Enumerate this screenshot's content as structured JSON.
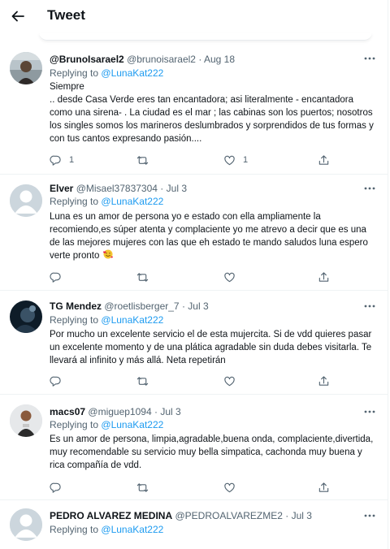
{
  "header": {
    "title": "Tweet"
  },
  "replying_label": "Replying to",
  "tweets": [
    {
      "name": "@BrunoIsarael2",
      "handle": "@brunoisarael2",
      "dot": "·",
      "date": "Aug 18",
      "reply_to": "@LunaKat222",
      "body": "Siempre\n.. desde Casa Verde eres tan encantadora; asi literalmente - encantadora como una sirena-  . La ciudad es el mar ; las cabinas son los puertos; nosotros los singles somos los marineros deslumbrados y sorprendidos  de tus formas y con tus cantos expresando pasión....",
      "replies": "1",
      "likes": "1"
    },
    {
      "name": "Elver",
      "handle": "@Misael37837304",
      "dot": "·",
      "date": "Jul 3",
      "reply_to": "@LunaKat222",
      "body": "Luna es un amor de persona yo e estado con ella ampliamente la recomiendo,es súper atenta y complaciente yo me atrevo a decir que es una de las mejores mujeres con las que eh estado te mando saludos luna espero verte pronto",
      "emoji": "smiling-face-with-hearts",
      "replies": "",
      "likes": ""
    },
    {
      "name": "TG Mendez",
      "handle": "@roetlisberger_7",
      "dot": "·",
      "date": "Jul 3",
      "reply_to": "@LunaKat222",
      "body": "Por mucho un excelente servicio el de esta mujercita. Si de vdd quieres pasar un excelente momento y de una plática agradable sin duda debes visitarla. Te llevará al infinito y más allá. Neta repetirán",
      "replies": "",
      "likes": ""
    },
    {
      "name": "macs07",
      "handle": "@miguep1094",
      "dot": "·",
      "date": "Jul 3",
      "reply_to": "@LunaKat222",
      "body": "Es un amor de persona, limpia,agradable,buena onda, complaciente,divertida, muy recomendable su servicio muy bella simpatica, cachonda muy buena y rica compañía de vdd.",
      "replies": "",
      "likes": ""
    },
    {
      "name": "PEDRO ALVAREZ MEDINA",
      "handle": "@PEDROALVAREZME2",
      "dot": "·",
      "date": "Jul 3",
      "reply_to": "@LunaKat222"
    }
  ],
  "colors": {
    "accent": "#1d9bf0",
    "secondary_text": "#536471",
    "border": "#eff3f4"
  },
  "icons": [
    "back-arrow-icon",
    "more-icon",
    "reply-icon",
    "retweet-icon",
    "like-icon",
    "share-icon"
  ]
}
